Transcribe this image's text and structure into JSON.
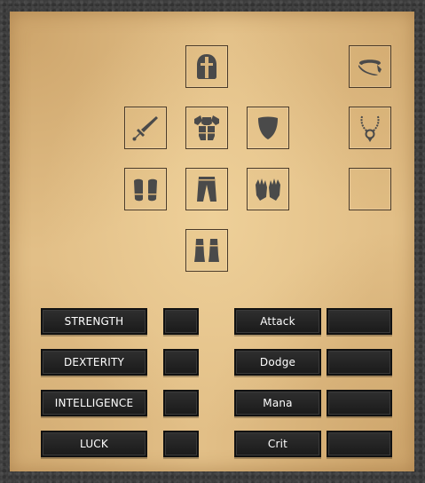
{
  "equipment": {
    "slots": [
      {
        "id": "helmet",
        "icon": "helmet-icon"
      },
      {
        "id": "ring",
        "icon": "ring-icon"
      },
      {
        "id": "weapon",
        "icon": "sword-icon"
      },
      {
        "id": "armor",
        "icon": "chest-armor-icon"
      },
      {
        "id": "shield",
        "icon": "shield-icon"
      },
      {
        "id": "necklace",
        "icon": "amulet-icon"
      },
      {
        "id": "bracers",
        "icon": "bracers-icon"
      },
      {
        "id": "pants",
        "icon": "pants-icon"
      },
      {
        "id": "gloves",
        "icon": "gloves-icon"
      },
      {
        "id": "extra",
        "icon": ""
      },
      {
        "id": "boots",
        "icon": "boots-icon"
      }
    ]
  },
  "attributes": {
    "strength": {
      "label": "STRENGTH",
      "value": ""
    },
    "dexterity": {
      "label": "DEXTERITY",
      "value": ""
    },
    "intelligence": {
      "label": "INTELLIGENCE",
      "value": ""
    },
    "luck": {
      "label": "LUCK",
      "value": ""
    }
  },
  "stats": {
    "attack": {
      "label": "Attack",
      "value": ""
    },
    "dodge": {
      "label": "Dodge",
      "value": ""
    },
    "mana": {
      "label": "Mana",
      "value": ""
    },
    "crit": {
      "label": "Crit",
      "value": ""
    }
  },
  "colors": {
    "parchment": "#e2bf87",
    "frame": "#3d3d3d",
    "plate": "#1f1f1f",
    "icon": "#4a4a4a"
  }
}
